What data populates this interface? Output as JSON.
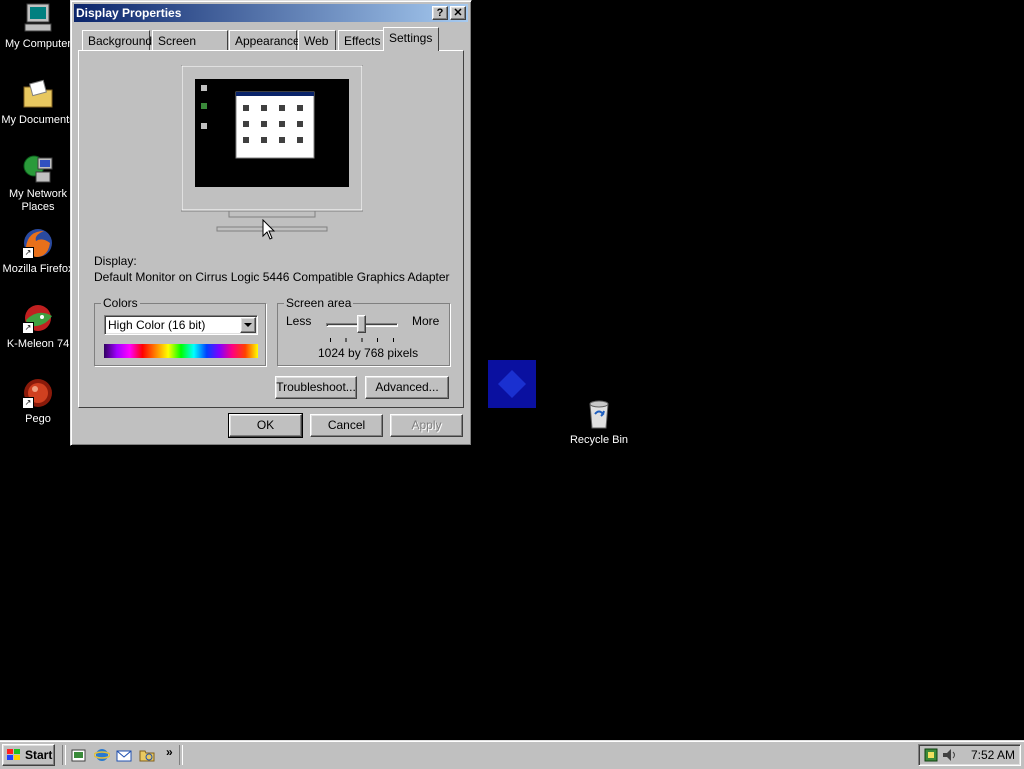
{
  "desktop": {
    "icons": [
      {
        "label": "My Computer"
      },
      {
        "label": "My Documents"
      },
      {
        "label": "My Network Places"
      },
      {
        "label": "Mozilla Firefox"
      },
      {
        "label": "K-Meleon 74"
      },
      {
        "label": "Pego"
      }
    ],
    "recycle_bin": "Recycle Bin"
  },
  "window": {
    "title": "Display Properties",
    "help_glyph": "?",
    "close_glyph": "✕",
    "tabs": [
      {
        "label": "Background"
      },
      {
        "label": "Screen Saver"
      },
      {
        "label": "Appearance"
      },
      {
        "label": "Web"
      },
      {
        "label": "Effects"
      },
      {
        "label": "Settings",
        "active": true
      }
    ],
    "display_label": "Display:",
    "display_value": "Default Monitor on Cirrus Logic 5446 Compatible Graphics Adapter",
    "colors": {
      "legend": "Colors",
      "selected": "High Color (16 bit)"
    },
    "screen_area": {
      "legend": "Screen area",
      "less": "Less",
      "more": "More",
      "value_text": "1024 by 768 pixels",
      "slider_position": 0.5
    },
    "buttons": {
      "troubleshoot": "Troubleshoot...",
      "advanced": "Advanced...",
      "ok": "OK",
      "cancel": "Cancel",
      "apply": "Apply"
    }
  },
  "taskbar": {
    "start": "Start",
    "chevron": "»",
    "clock": "7:52 AM"
  },
  "colors": {
    "desktop": "#000000",
    "title_active": "#0a246a",
    "face": "#c0c0c0"
  }
}
